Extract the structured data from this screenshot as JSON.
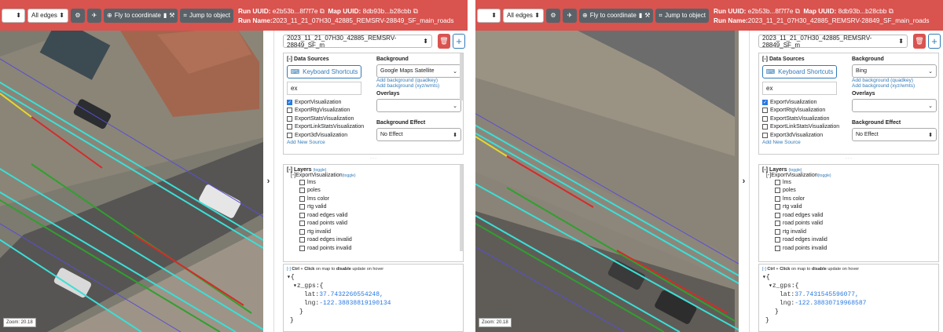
{
  "panes": [
    {
      "topbar": {
        "edges_select": "All edges",
        "fly_label": "Fly to coordinate",
        "jump_label": "Jump to object",
        "run_uuid_label": "Run UUID:",
        "run_uuid": "e2b53b...8f7f7e",
        "map_uuid_label": "Map UUID:",
        "map_uuid": "8db93b...b28cbb",
        "run_name_label": "Run Name:",
        "run_name": "2023_11_21_07H30_42885_REMSRV-28849_SF_main_roads"
      },
      "map": {
        "zoom": "Zoom: 20.18"
      },
      "panel": {
        "run_select": "2023_11_21_07H30_42885_REMSRV-28849_SF_m",
        "data_sources": {
          "header": "[-] Data Sources",
          "keyboard_shortcuts": "Keyboard Shortcuts",
          "filter": "ex",
          "items": [
            {
              "label": "ExportVisualization",
              "checked": true
            },
            {
              "label": "ExportRtgVisualization",
              "checked": false
            },
            {
              "label": "ExportStatsVisualization",
              "checked": false
            },
            {
              "label": "ExportLinkStatsVisualization",
              "checked": false
            },
            {
              "label": "Export3dVisualization",
              "checked": false
            }
          ],
          "add_new": "Add New Source"
        },
        "background": {
          "header": "Background",
          "selected": "Google Maps Satellite",
          "add_quadkey": "Add background (quadkey)",
          "add_xyz": "Add background (xyz/wmts)",
          "overlays_header": "Overlays",
          "effect_header": "Background Effect",
          "effect": "No Effect"
        },
        "layers": {
          "header": "[-] Layers",
          "toggle": "(toggle)",
          "group": "[-]ExportVisualization",
          "items": [
            "lms",
            "poles",
            "lms color",
            "rtg valid",
            "road edges valid",
            "road points valid",
            "rtg invalid",
            "road edges invalid",
            "road points invalid"
          ]
        },
        "hover": {
          "header_prefix": "[-] ",
          "ctrl": "Ctrl",
          "plus": " + ",
          "click": "Click",
          "mid": " on map to ",
          "disable": "disable",
          "rest": " update on hover",
          "open_brace": "{",
          "key": "z_gps",
          "lat_label": "lat:",
          "lat": "37.7432260554248,",
          "lng_label": "lng:",
          "lng": "-122.38838819190134",
          "close_inner": "}",
          "close_outer": "}"
        }
      }
    },
    {
      "topbar": {
        "edges_select": "All edges",
        "fly_label": "Fly to coordinate",
        "jump_label": "Jump to object",
        "run_uuid_label": "Run UUID:",
        "run_uuid": "e2b53b...8f7f7e",
        "map_uuid_label": "Map UUID:",
        "map_uuid": "8db93b...b28cbb",
        "run_name_label": "Run Name:",
        "run_name": "2023_11_21_07H30_42885_REMSRV-28849_SF_main_roads"
      },
      "map": {
        "zoom": "Zoom: 20.18"
      },
      "panel": {
        "run_select": "2023_11_21_07H30_42885_REMSRV-28849_SF_m",
        "data_sources": {
          "header": "[-] Data Sources",
          "keyboard_shortcuts": "Keyboard Shortcuts",
          "filter": "ex",
          "items": [
            {
              "label": "ExportVisualization",
              "checked": true
            },
            {
              "label": "ExportRtgVisualization",
              "checked": false
            },
            {
              "label": "ExportStatsVisualization",
              "checked": false
            },
            {
              "label": "ExportLinkStatsVisualization",
              "checked": false
            },
            {
              "label": "Export3dVisualization",
              "checked": false
            }
          ],
          "add_new": "Add New Source"
        },
        "background": {
          "header": "Background",
          "selected": "Bing",
          "add_quadkey": "Add background (quadkey)",
          "add_xyz": "Add background (xyz/wmts)",
          "overlays_header": "Overlays",
          "effect_header": "Background Effect",
          "effect": "No Effect"
        },
        "layers": {
          "header": "[-] Layers",
          "toggle": "(toggle)",
          "group": "[-]ExportVisualization",
          "items": [
            "lms",
            "poles",
            "lms color",
            "rtg valid",
            "road edges valid",
            "road points valid",
            "rtg invalid",
            "road edges invalid",
            "road points invalid"
          ]
        },
        "hover": {
          "header_prefix": "[-] ",
          "ctrl": "Ctrl",
          "plus": " + ",
          "click": "Click",
          "mid": " on map to ",
          "disable": "disable",
          "rest": " update on hover",
          "open_brace": "{",
          "key": "z_gps",
          "lat_label": "lat:",
          "lat": "37.7431545596077,",
          "lng_label": "lng:",
          "lng": "-122.38830719968587",
          "close_inner": "}",
          "close_outer": "}"
        }
      }
    }
  ],
  "colors": {
    "topbar": "#d9534f",
    "link": "#337ab7",
    "checkbox_on": "#2a7ae2",
    "lane_cyan": "#38e0d8",
    "lane_blue": "#5a4fd0",
    "lane_green": "#2fa02f",
    "lane_red": "#d62a2a",
    "lane_yellow": "#e8d82a"
  }
}
